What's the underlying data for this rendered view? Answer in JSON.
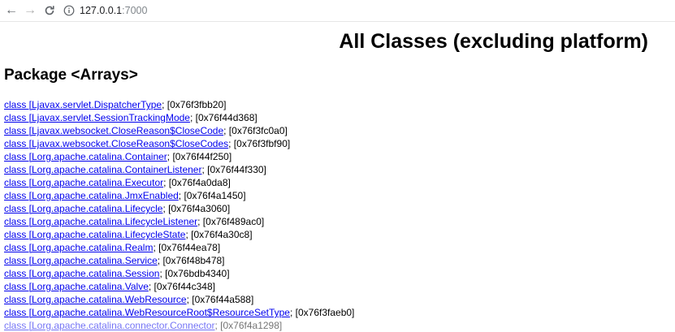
{
  "browser": {
    "back_label": "←",
    "forward_label": "→",
    "reload_label": "C",
    "url_host": "127.0.0.1",
    "url_port": ":7000"
  },
  "page": {
    "title": "All Classes (excluding platform)",
    "package_heading": "Package <Arrays>"
  },
  "classes": [
    {
      "name": "class [Ljavax.servlet.DispatcherType",
      "address": "; [0x76f3fbb20]"
    },
    {
      "name": "class [Ljavax.servlet.SessionTrackingMode",
      "address": "; [0x76f44d368]"
    },
    {
      "name": "class [Ljavax.websocket.CloseReason$CloseCode",
      "address": "; [0x76f3fc0a0]"
    },
    {
      "name": "class [Ljavax.websocket.CloseReason$CloseCodes",
      "address": "; [0x76f3fbf90]"
    },
    {
      "name": "class [Lorg.apache.catalina.Container",
      "address": "; [0x76f44f250]"
    },
    {
      "name": "class [Lorg.apache.catalina.ContainerListener",
      "address": "; [0x76f44f330]"
    },
    {
      "name": "class [Lorg.apache.catalina.Executor",
      "address": "; [0x76f4a0da8]"
    },
    {
      "name": "class [Lorg.apache.catalina.JmxEnabled",
      "address": "; [0x76f4a1450]"
    },
    {
      "name": "class [Lorg.apache.catalina.Lifecycle",
      "address": "; [0x76f4a3060]"
    },
    {
      "name": "class [Lorg.apache.catalina.LifecycleListener",
      "address": "; [0x76f489ac0]"
    },
    {
      "name": "class [Lorg.apache.catalina.LifecycleState",
      "address": "; [0x76f4a30c8]"
    },
    {
      "name": "class [Lorg.apache.catalina.Realm",
      "address": "; [0x76f44ea78]"
    },
    {
      "name": "class [Lorg.apache.catalina.Service",
      "address": "; [0x76f48b478]"
    },
    {
      "name": "class [Lorg.apache.catalina.Session",
      "address": "; [0x76bdb4340]"
    },
    {
      "name": "class [Lorg.apache.catalina.Valve",
      "address": "; [0x76f44c348]"
    },
    {
      "name": "class [Lorg.apache.catalina.WebResource",
      "address": "; [0x76f44a588]"
    },
    {
      "name": "class [Lorg.apache.catalina.WebResourceRoot$ResourceSetType",
      "address": "; [0x76f3faeb0]"
    },
    {
      "name": "class [Lorg.apache.catalina.connector.Connector",
      "address": "; [0x76f4a1298]"
    }
  ],
  "colors": {
    "link": "#0000ee",
    "text": "#000000",
    "toolbar_icon": "#5f6368"
  },
  "icons": {
    "back": "arrow-left-icon",
    "forward": "arrow-right-icon",
    "reload": "reload-icon",
    "info": "info-icon"
  }
}
